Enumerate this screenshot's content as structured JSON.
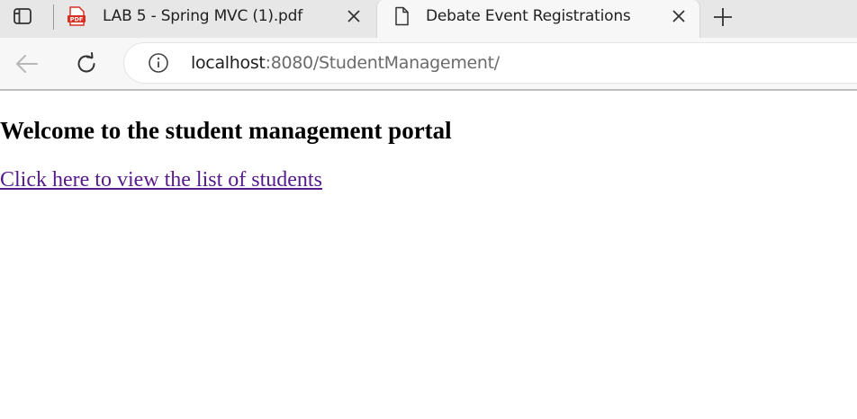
{
  "browser": {
    "tabs": [
      {
        "title": "LAB 5 - Spring MVC (1).pdf",
        "favicon": "pdf-icon",
        "favicon_text": "PDF",
        "active": false
      },
      {
        "title": "Debate Event Registrations",
        "favicon": "document-icon",
        "active": true
      }
    ],
    "address": {
      "host": "localhost",
      "path": ":8080/StudentManagement/"
    }
  },
  "page": {
    "heading": "Welcome to the student management portal",
    "link_text": "Click here to view the list of students"
  },
  "colors": {
    "tabstrip_bg": "#e7e7e7",
    "toolbar_bg": "#f7f7f7",
    "visited_link": "#551a8b",
    "pdf_red": "#d93025"
  }
}
